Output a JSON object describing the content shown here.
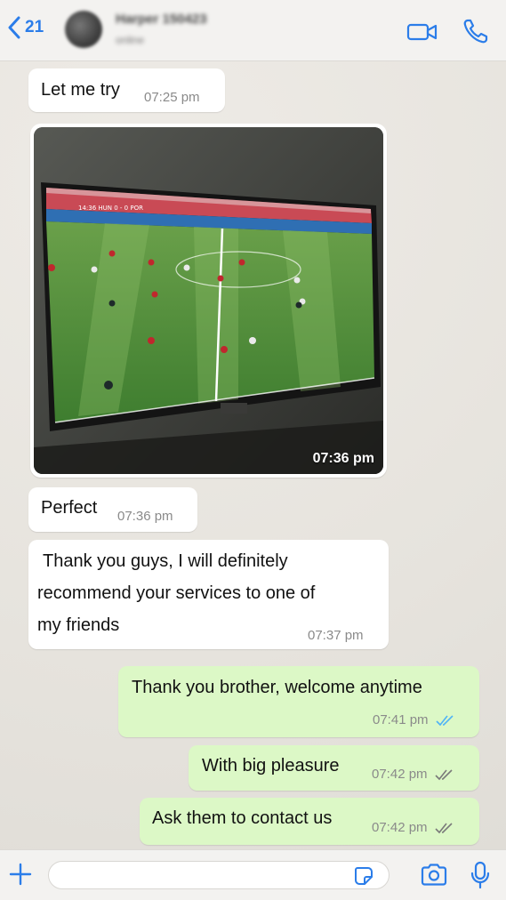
{
  "header": {
    "back_count": "21",
    "contact_name": "Harper 150423",
    "contact_status": "online"
  },
  "messages": [
    {
      "direction": "incoming",
      "text": "Let me try",
      "time": "07:25 pm"
    },
    {
      "direction": "incoming",
      "type": "photo",
      "time": "07:36 pm",
      "tv_scoreline": "14:36  HUN  0 - 0  POR"
    },
    {
      "direction": "incoming",
      "text": "Perfect",
      "time": "07:36 pm"
    },
    {
      "direction": "incoming",
      "lines": [
        "Thank you guys, I will definitely",
        "recommend your services to one of",
        "my friends"
      ],
      "time": "07:37 pm"
    },
    {
      "direction": "outgoing",
      "text": "Thank you brother, welcome anytime",
      "time": "07:41 pm",
      "status": "read"
    },
    {
      "direction": "outgoing",
      "text": "With big pleasure",
      "time": "07:42 pm",
      "status": "delivered"
    },
    {
      "direction": "outgoing",
      "text": "Ask them to contact us",
      "time": "07:42 pm",
      "status": "delivered"
    }
  ],
  "composer": {
    "placeholder": ""
  },
  "colors": {
    "accent": "#2b7de9",
    "incoming_bubble": "#ffffff",
    "outgoing_bubble": "#dcf8c6",
    "read_ticks": "#4fb3f6",
    "delivered_ticks": "#7a7a7a"
  },
  "icons": {
    "back": "chevron-left-icon",
    "video": "video-camera-icon",
    "call": "phone-icon",
    "attach": "plus-icon",
    "sticker": "sticker-icon",
    "camera": "camera-icon",
    "mic": "microphone-icon"
  }
}
